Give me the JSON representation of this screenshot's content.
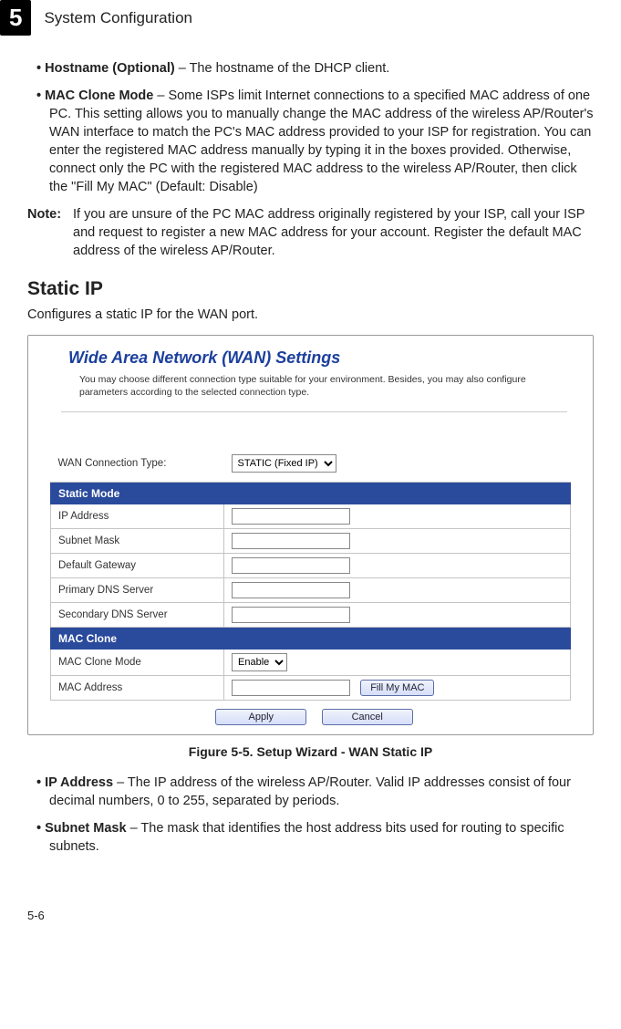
{
  "header": {
    "chapter_number": "5",
    "chapter_title": "System Configuration"
  },
  "bullets_top": [
    {
      "term": "Hostname (Optional)",
      "body": " – The hostname of the DHCP client."
    },
    {
      "term": "MAC Clone Mode",
      "body": " – Some ISPs limit Internet connections to a specified MAC address of one PC. This setting allows you to manually change the MAC address of the wireless AP/Router's WAN interface to match the PC's MAC address provided to your ISP for registration. You can enter the registered MAC address manually by typing it in the boxes provided. Otherwise, connect only the PC with the registered MAC address to the wireless AP/Router, then click the \"Fill My MAC\" (Default: Disable)"
    }
  ],
  "note": {
    "label": "Note:",
    "body": "If you are unsure of the PC MAC address originally registered by your ISP, call your ISP and request to register a new MAC address for your account. Register the default MAC address of the wireless AP/Router."
  },
  "section_title": "Static IP",
  "section_desc": "Configures a static IP for the WAN port.",
  "figure": {
    "panel_title": "Wide Area Network (WAN) Settings",
    "panel_desc": "You may choose different connection type suitable for your environment. Besides, you may also configure parameters according to the selected connection type.",
    "conn_type_label": "WAN Connection Type:",
    "conn_type_value": "STATIC (Fixed IP)",
    "section_static": "Static Mode",
    "row_ip": "IP Address",
    "row_subnet": "Subnet Mask",
    "row_gateway": "Default Gateway",
    "row_dns1": "Primary DNS Server",
    "row_dns2": "Secondary DNS Server",
    "section_mac": "MAC Clone",
    "row_mac_mode": "MAC Clone Mode",
    "mac_mode_value": "Enable",
    "row_mac_addr": "MAC Address",
    "btn_fill": "Fill My MAC",
    "btn_apply": "Apply",
    "btn_cancel": "Cancel",
    "caption": "Figure 5-5.   Setup Wizard - WAN Static IP"
  },
  "bullets_bottom": [
    {
      "term": "IP Address",
      "body": " – The IP address of the wireless AP/Router. Valid IP addresses consist of four decimal numbers, 0 to 255, separated by periods."
    },
    {
      "term": "Subnet Mask",
      "body": " – The mask that identifies the host address bits used for routing to specific subnets."
    }
  ],
  "page_number": "5-6"
}
